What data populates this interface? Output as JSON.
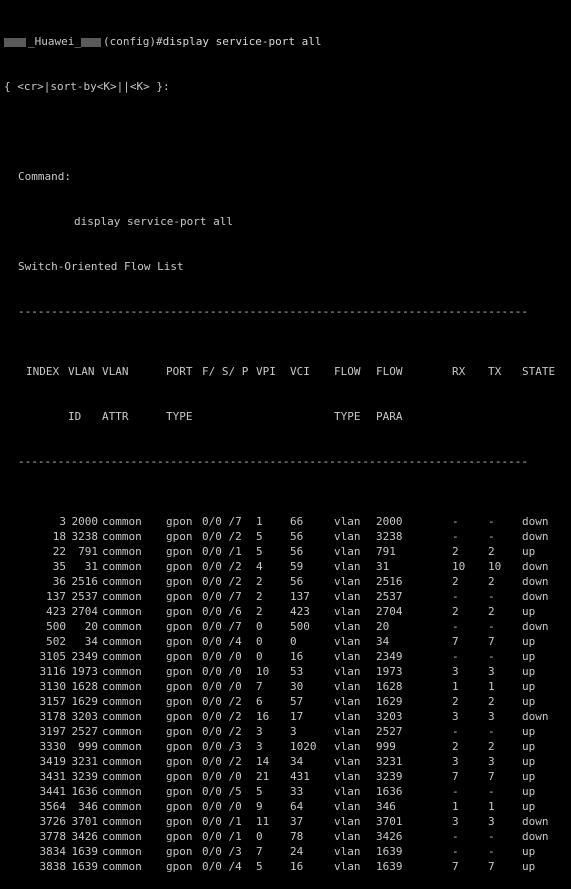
{
  "prompt": {
    "host": "_Huawei_",
    "suffix": "(config)#",
    "command": "display service-port all"
  },
  "hint": "{ <cr>|sort-by<K>||<K> }:",
  "command_label": "Command:",
  "command_echo": "display service-port all",
  "list_title": "Switch-Oriented Flow List",
  "separator": "-----------------------------------------------------------------------------",
  "headers": {
    "index": "INDEX",
    "vlan_id": [
      "VLAN",
      "ID"
    ],
    "vlan_attr": [
      "VLAN",
      "ATTR"
    ],
    "port_type": [
      "PORT",
      "TYPE"
    ],
    "fsp": "F/ S/ P",
    "vpi": "VPI",
    "vci": "VCI",
    "flow_type": [
      "FLOW",
      "TYPE"
    ],
    "flow_para": [
      "FLOW",
      "PARA"
    ],
    "rx": "RX",
    "tx": "TX",
    "state": "STATE"
  },
  "rows": [
    {
      "index": "3",
      "vlan": "2000",
      "attr": "common",
      "type": "gpon",
      "fsp": "0/0 /7",
      "vpi": "1",
      "vci": "66",
      "ftype": "vlan",
      "fpara": "2000",
      "rx": "-",
      "tx": "-",
      "state": "down"
    },
    {
      "index": "18",
      "vlan": "3238",
      "attr": "common",
      "type": "gpon",
      "fsp": "0/0 /2",
      "vpi": "5",
      "vci": "56",
      "ftype": "vlan",
      "fpara": "3238",
      "rx": "-",
      "tx": "-",
      "state": "down"
    },
    {
      "index": "22",
      "vlan": "791",
      "attr": "common",
      "type": "gpon",
      "fsp": "0/0 /1",
      "vpi": "5",
      "vci": "56",
      "ftype": "vlan",
      "fpara": "791",
      "rx": "2",
      "tx": "2",
      "state": "up"
    },
    {
      "index": "35",
      "vlan": "31",
      "attr": "common",
      "type": "gpon",
      "fsp": "0/0 /2",
      "vpi": "4",
      "vci": "59",
      "ftype": "vlan",
      "fpara": "31",
      "rx": "10",
      "tx": "10",
      "state": "down"
    },
    {
      "index": "36",
      "vlan": "2516",
      "attr": "common",
      "type": "gpon",
      "fsp": "0/0 /2",
      "vpi": "2",
      "vci": "56",
      "ftype": "vlan",
      "fpara": "2516",
      "rx": "2",
      "tx": "2",
      "state": "down"
    },
    {
      "index": "137",
      "vlan": "2537",
      "attr": "common",
      "type": "gpon",
      "fsp": "0/0 /7",
      "vpi": "2",
      "vci": "137",
      "ftype": "vlan",
      "fpara": "2537",
      "rx": "-",
      "tx": "-",
      "state": "down"
    },
    {
      "index": "423",
      "vlan": "2704",
      "attr": "common",
      "type": "gpon",
      "fsp": "0/0 /6",
      "vpi": "2",
      "vci": "423",
      "ftype": "vlan",
      "fpara": "2704",
      "rx": "2",
      "tx": "2",
      "state": "up"
    },
    {
      "index": "500",
      "vlan": "20",
      "attr": "common",
      "type": "gpon",
      "fsp": "0/0 /7",
      "vpi": "0",
      "vci": "500",
      "ftype": "vlan",
      "fpara": "20",
      "rx": "-",
      "tx": "-",
      "state": "down"
    },
    {
      "index": "502",
      "vlan": "34",
      "attr": "common",
      "type": "gpon",
      "fsp": "0/0 /4",
      "vpi": "0",
      "vci": "0",
      "ftype": "vlan",
      "fpara": "34",
      "rx": "7",
      "tx": "7",
      "state": "up"
    },
    {
      "index": "3105",
      "vlan": "2349",
      "attr": "common",
      "type": "gpon",
      "fsp": "0/0 /0",
      "vpi": "0",
      "vci": "16",
      "ftype": "vlan",
      "fpara": "2349",
      "rx": "-",
      "tx": "-",
      "state": "up"
    },
    {
      "index": "3116",
      "vlan": "1973",
      "attr": "common",
      "type": "gpon",
      "fsp": "0/0 /0",
      "vpi": "10",
      "vci": "53",
      "ftype": "vlan",
      "fpara": "1973",
      "rx": "3",
      "tx": "3",
      "state": "up"
    },
    {
      "index": "3130",
      "vlan": "1628",
      "attr": "common",
      "type": "gpon",
      "fsp": "0/0 /0",
      "vpi": "7",
      "vci": "30",
      "ftype": "vlan",
      "fpara": "1628",
      "rx": "1",
      "tx": "1",
      "state": "up"
    },
    {
      "index": "3157",
      "vlan": "1629",
      "attr": "common",
      "type": "gpon",
      "fsp": "0/0 /2",
      "vpi": "6",
      "vci": "57",
      "ftype": "vlan",
      "fpara": "1629",
      "rx": "2",
      "tx": "2",
      "state": "up"
    },
    {
      "index": "3178",
      "vlan": "3203",
      "attr": "common",
      "type": "gpon",
      "fsp": "0/0 /2",
      "vpi": "16",
      "vci": "17",
      "ftype": "vlan",
      "fpara": "3203",
      "rx": "3",
      "tx": "3",
      "state": "down"
    },
    {
      "index": "3197",
      "vlan": "2527",
      "attr": "common",
      "type": "gpon",
      "fsp": "0/0 /2",
      "vpi": "3",
      "vci": "3",
      "ftype": "vlan",
      "fpara": "2527",
      "rx": "-",
      "tx": "-",
      "state": "up"
    },
    {
      "index": "3330",
      "vlan": "999",
      "attr": "common",
      "type": "gpon",
      "fsp": "0/0 /3",
      "vpi": "3",
      "vci": "1020",
      "ftype": "vlan",
      "fpara": "999",
      "rx": "2",
      "tx": "2",
      "state": "up"
    },
    {
      "index": "3419",
      "vlan": "3231",
      "attr": "common",
      "type": "gpon",
      "fsp": "0/0 /2",
      "vpi": "14",
      "vci": "34",
      "ftype": "vlan",
      "fpara": "3231",
      "rx": "3",
      "tx": "3",
      "state": "up"
    },
    {
      "index": "3431",
      "vlan": "3239",
      "attr": "common",
      "type": "gpon",
      "fsp": "0/0 /0",
      "vpi": "21",
      "vci": "431",
      "ftype": "vlan",
      "fpara": "3239",
      "rx": "7",
      "tx": "7",
      "state": "up"
    },
    {
      "index": "3441",
      "vlan": "1636",
      "attr": "common",
      "type": "gpon",
      "fsp": "0/0 /5",
      "vpi": "5",
      "vci": "33",
      "ftype": "vlan",
      "fpara": "1636",
      "rx": "-",
      "tx": "-",
      "state": "up"
    },
    {
      "index": "3564",
      "vlan": "346",
      "attr": "common",
      "type": "gpon",
      "fsp": "0/0 /0",
      "vpi": "9",
      "vci": "64",
      "ftype": "vlan",
      "fpara": "346",
      "rx": "1",
      "tx": "1",
      "state": "up"
    },
    {
      "index": "3726",
      "vlan": "3701",
      "attr": "common",
      "type": "gpon",
      "fsp": "0/0 /1",
      "vpi": "11",
      "vci": "37",
      "ftype": "vlan",
      "fpara": "3701",
      "rx": "3",
      "tx": "3",
      "state": "down"
    },
    {
      "index": "3778",
      "vlan": "3426",
      "attr": "common",
      "type": "gpon",
      "fsp": "0/0 /1",
      "vpi": "0",
      "vci": "78",
      "ftype": "vlan",
      "fpara": "3426",
      "rx": "-",
      "tx": "-",
      "state": "down"
    },
    {
      "index": "3834",
      "vlan": "1639",
      "attr": "common",
      "type": "gpon",
      "fsp": "0/0 /3",
      "vpi": "7",
      "vci": "24",
      "ftype": "vlan",
      "fpara": "1639",
      "rx": "-",
      "tx": "-",
      "state": "up"
    },
    {
      "index": "3838",
      "vlan": "1639",
      "attr": "common",
      "type": "gpon",
      "fsp": "0/0 /4",
      "vpi": "5",
      "vci": "16",
      "ftype": "vlan",
      "fpara": "1639",
      "rx": "7",
      "tx": "7",
      "state": "up"
    }
  ]
}
